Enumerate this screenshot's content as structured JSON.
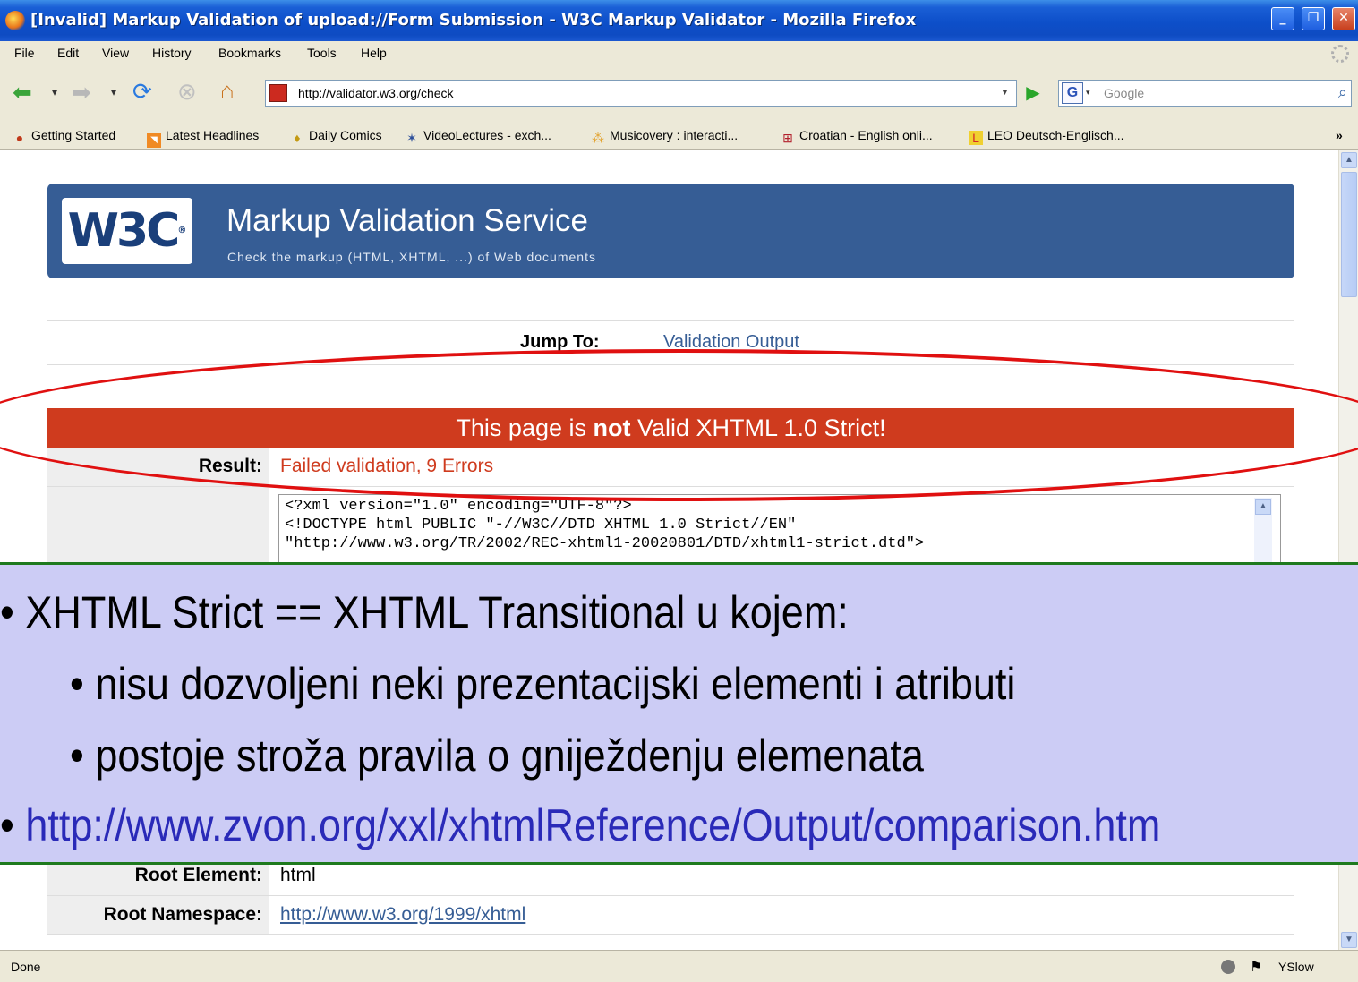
{
  "window": {
    "title": "[Invalid] Markup Validation of upload://Form Submission - W3C Markup Validator - Mozilla Firefox",
    "minimize": "_",
    "maximize": "❐",
    "close": "✕"
  },
  "menu": {
    "file": "File",
    "edit": "Edit",
    "view": "View",
    "history": "History",
    "bookmarks": "Bookmarks",
    "tools": "Tools",
    "help": "Help"
  },
  "nav": {
    "url": "http://validator.w3.org/check",
    "search_placeholder": "Google"
  },
  "bookmarks_bar": {
    "items": [
      "Getting Started",
      "Latest Headlines",
      "Daily Comics",
      "VideoLectures - exch...",
      "Musicovery : interacti...",
      "Croatian - English onli...",
      "LEO Deutsch-Englisch..."
    ],
    "overflow": "»"
  },
  "banner": {
    "logo": "W3C",
    "logo_mark": "®",
    "title": "Markup Validation Service",
    "subtitle": "Check the markup (HTML, XHTML, ...) of Web documents"
  },
  "jump": {
    "label": "Jump To:",
    "link": "Validation Output"
  },
  "result": {
    "banner_pre": "This page is ",
    "banner_bold": "not",
    "banner_post": " Valid XHTML 1.0 Strict!",
    "label": "Result:",
    "value": "Failed validation, 9 Errors"
  },
  "source": {
    "lines": [
      "<?xml version=\"1.0\" encoding=\"UTF-8\"?>",
      "<!DOCTYPE html PUBLIC \"-//W3C//DTD XHTML 1.0 Strict//EN\"",
      "\"http://www.w3.org/TR/2002/REC-xhtml1-20020801/DTD/xhtml1-strict.dtd\">"
    ]
  },
  "root": {
    "label": "Root Element:",
    "value": "html"
  },
  "namespace": {
    "label": "Root Namespace:",
    "value": "http://www.w3.org/1999/xhtml"
  },
  "overlay": {
    "line1": "XHTML Strict == XHTML Transitional u kojem:",
    "line2": "nisu dozvoljeni neki prezentacijski elementi i atributi",
    "line3": "postoje stroža pravila o gniježdenju elemenata",
    "line4": "http://www.zvon.org/xxl/xhtmlReference/Output/comparison.htm",
    "bullet": "•",
    "link_color": "#2a2ab8"
  },
  "status": {
    "text": "Done",
    "yslow": "YSlow"
  },
  "colors": {
    "w3c_blue": "#365d95",
    "error_red": "#cf3b1e",
    "overlay_bg": "#ccccf5",
    "annotation": "#e01010"
  }
}
